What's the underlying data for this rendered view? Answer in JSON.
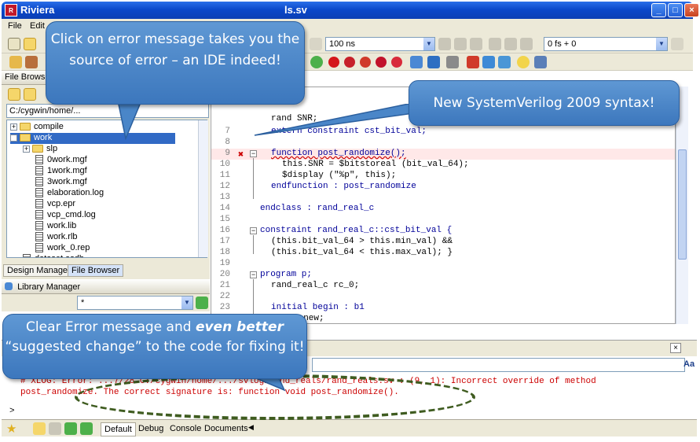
{
  "window": {
    "title_left": "Riviera",
    "title_right": "ls.sv",
    "logo_text": "R",
    "controls": [
      "_",
      "□",
      "×"
    ]
  },
  "menu": {
    "items": [
      "File",
      "Edit"
    ]
  },
  "toolbar": {
    "time_combo": "100 ns",
    "time_combo2": "0 fs + 0"
  },
  "left_panel": {
    "header": "File Brows",
    "path": "C:/cygwin/home/...",
    "tree": [
      {
        "label": "compile",
        "type": "folder",
        "indent": 0,
        "expander": "+"
      },
      {
        "label": "work",
        "type": "folder",
        "indent": 0,
        "expander": "-",
        "selected": true
      },
      {
        "label": "slp",
        "type": "folder",
        "indent": 1,
        "expander": "+"
      },
      {
        "label": "0work.mgf",
        "type": "file",
        "indent": 2
      },
      {
        "label": "1work.mgf",
        "type": "file",
        "indent": 2
      },
      {
        "label": "3work.mgf",
        "type": "file",
        "indent": 2
      },
      {
        "label": "elaboration.log",
        "type": "file",
        "indent": 2
      },
      {
        "label": "vcp.epr",
        "type": "file",
        "indent": 2
      },
      {
        "label": "vcp_cmd.log",
        "type": "file",
        "indent": 2
      },
      {
        "label": "work.lib",
        "type": "file",
        "indent": 2
      },
      {
        "label": "work.rlb",
        "type": "file",
        "indent": 2
      },
      {
        "label": "work_0.rep",
        "type": "file",
        "indent": 2
      },
      {
        "label": "dataset.asdb",
        "type": "file",
        "indent": 1
      }
    ],
    "tabs": [
      "Design Manager",
      "File Browser"
    ],
    "library_header": "Library Manager",
    "library_filter": "*"
  },
  "editor": {
    "partial_top": "rand SNR;",
    "lines": [
      {
        "n": "7",
        "code": "extern constraint cst_bit_val;",
        "indent": 1
      },
      {
        "n": "8",
        "code": "",
        "indent": 0
      },
      {
        "n": "9",
        "code": "function post_randomize();",
        "indent": 1,
        "error": true
      },
      {
        "n": "10",
        "code": "this.SNR = $bitstoreal (bit_val_64);",
        "indent": 2
      },
      {
        "n": "11",
        "code": "$display (\"%p\", this);",
        "indent": 2
      },
      {
        "n": "12",
        "code": "endfunction : post_randomize",
        "indent": 1
      },
      {
        "n": "13",
        "code": "",
        "indent": 0
      },
      {
        "n": "14",
        "code": "endclass : rand_real_c",
        "indent": 0
      },
      {
        "n": "15",
        "code": "",
        "indent": 0
      },
      {
        "n": "16",
        "code": "constraint rand_real_c::cst_bit_val {",
        "indent": 0
      },
      {
        "n": "17",
        "code": "(this.bit_val_64 > this.min_val) &&",
        "indent": 1
      },
      {
        "n": "18",
        "code": "(this.bit_val_64 < this.max_val); }",
        "indent": 1
      },
      {
        "n": "19",
        "code": "",
        "indent": 0
      },
      {
        "n": "20",
        "code": "program p;",
        "indent": 0
      },
      {
        "n": "21",
        "code": "rand_real_c rc_0;",
        "indent": 1
      },
      {
        "n": "22",
        "code": "",
        "indent": 0
      },
      {
        "n": "23",
        "code": "initial begin : b1",
        "indent": 1
      },
      {
        "n": "24",
        "code": "= new;",
        "indent": 3
      }
    ]
  },
  "console": {
    "line1": "# XLOG: Error: ...7/28 C:/cygwin/home/.../svlog/rand_reals/rand_reals.sv : (9, 1): Incorrect override of method",
    "line2": "post_randomize. The correct signature is: function void post_randomize().",
    "prompt": ">",
    "search_button": "Aa",
    "tabs": [
      "Default",
      "Debug",
      "Console",
      "Documents"
    ]
  },
  "callouts": {
    "c1": "Click on error message takes you the source of error – an IDE indeed!",
    "c2": "New SystemVerilog 2009 syntax!",
    "c3_pre": "Clear Error message and ",
    "c3_em": "even better",
    "c3_post": "“suggested change” to the code for fixing it!"
  },
  "colors": {
    "callout_fill": "#4a86c8",
    "error_text": "#cc0000",
    "keyword": "#000099",
    "ellipse": "#3f5c20"
  }
}
